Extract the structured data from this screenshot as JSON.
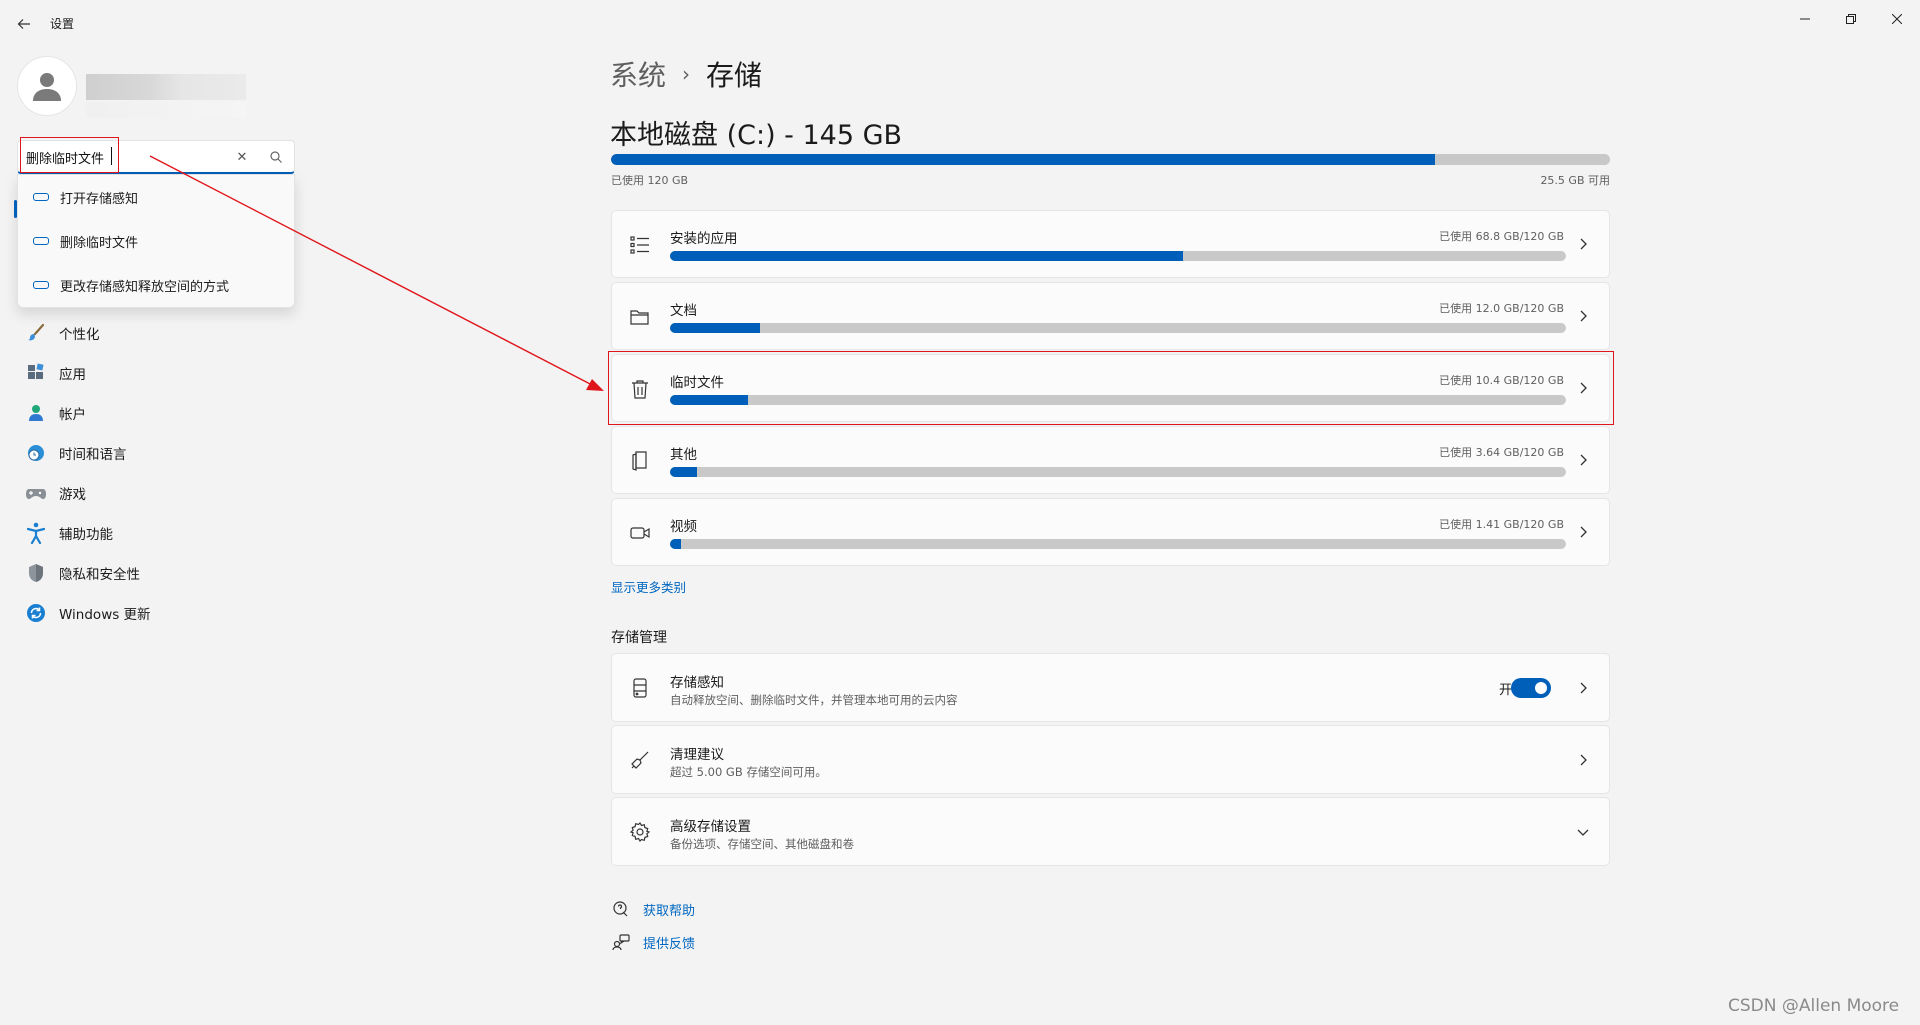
{
  "window": {
    "title": "设置",
    "back_icon": "back-arrow-icon",
    "controls": [
      "minimize-icon",
      "restore-icon",
      "close-icon"
    ]
  },
  "search": {
    "value": "删除临时文件",
    "suggestions": [
      "打开存储感知",
      "删除临时文件",
      "更改存储感知释放空间的方式"
    ]
  },
  "nav": {
    "items": [
      {
        "label": "个性化",
        "icon": "paintbrush-icon"
      },
      {
        "label": "应用",
        "icon": "apps-icon"
      },
      {
        "label": "帐户",
        "icon": "account-icon"
      },
      {
        "label": "时间和语言",
        "icon": "globe-clock-icon"
      },
      {
        "label": "游戏",
        "icon": "gamepad-icon"
      },
      {
        "label": "辅助功能",
        "icon": "accessibility-icon"
      },
      {
        "label": "隐私和安全性",
        "icon": "shield-icon"
      },
      {
        "label": "Windows 更新",
        "icon": "update-icon"
      }
    ]
  },
  "breadcrumb": {
    "parent": "系统",
    "separator": "›",
    "current": "存储"
  },
  "disk": {
    "title": "本地磁盘 (C:) - 145 GB",
    "used_label": "已使用 120 GB",
    "free_label": "25.5 GB 可用",
    "used_fraction": 0.825
  },
  "categories": [
    {
      "name": "安装的应用",
      "usage": "已使用 68.8 GB/120 GB",
      "fraction": 0.573,
      "icon": "list-icon"
    },
    {
      "name": "文档",
      "usage": "已使用 12.0 GB/120 GB",
      "fraction": 0.1,
      "icon": "folder-icon"
    },
    {
      "name": "临时文件",
      "usage": "已使用 10.4 GB/120 GB",
      "fraction": 0.087,
      "icon": "trash-icon"
    },
    {
      "name": "其他",
      "usage": "已使用 3.64 GB/120 GB",
      "fraction": 0.03,
      "icon": "other-files-icon"
    },
    {
      "name": "视频",
      "usage": "已使用 1.41 GB/120 GB",
      "fraction": 0.012,
      "icon": "video-icon"
    }
  ],
  "more_categories_link": "显示更多类别",
  "storage_management": {
    "title": "存储管理",
    "items": [
      {
        "title": "存储感知",
        "desc": "自动释放空间、删除临时文件，并管理本地可用的云内容",
        "toggle_label": "开",
        "toggle_on": true,
        "icon": "storage-sense-icon"
      },
      {
        "title": "清理建议",
        "desc": "超过 5.00 GB 存储空间可用。",
        "icon": "broom-icon"
      },
      {
        "title": "高级存储设置",
        "desc": "备份选项、存储空间、其他磁盘和卷",
        "icon": "gear-icon"
      }
    ]
  },
  "help": {
    "get_help": "获取帮助",
    "feedback": "提供反馈"
  },
  "watermark": "CSDN @Allen Moore",
  "colors": {
    "accent": "#005fb8",
    "annotation_red": "#e0151b",
    "bar_track": "#c9c9c9",
    "background": "#f3f3f3"
  }
}
